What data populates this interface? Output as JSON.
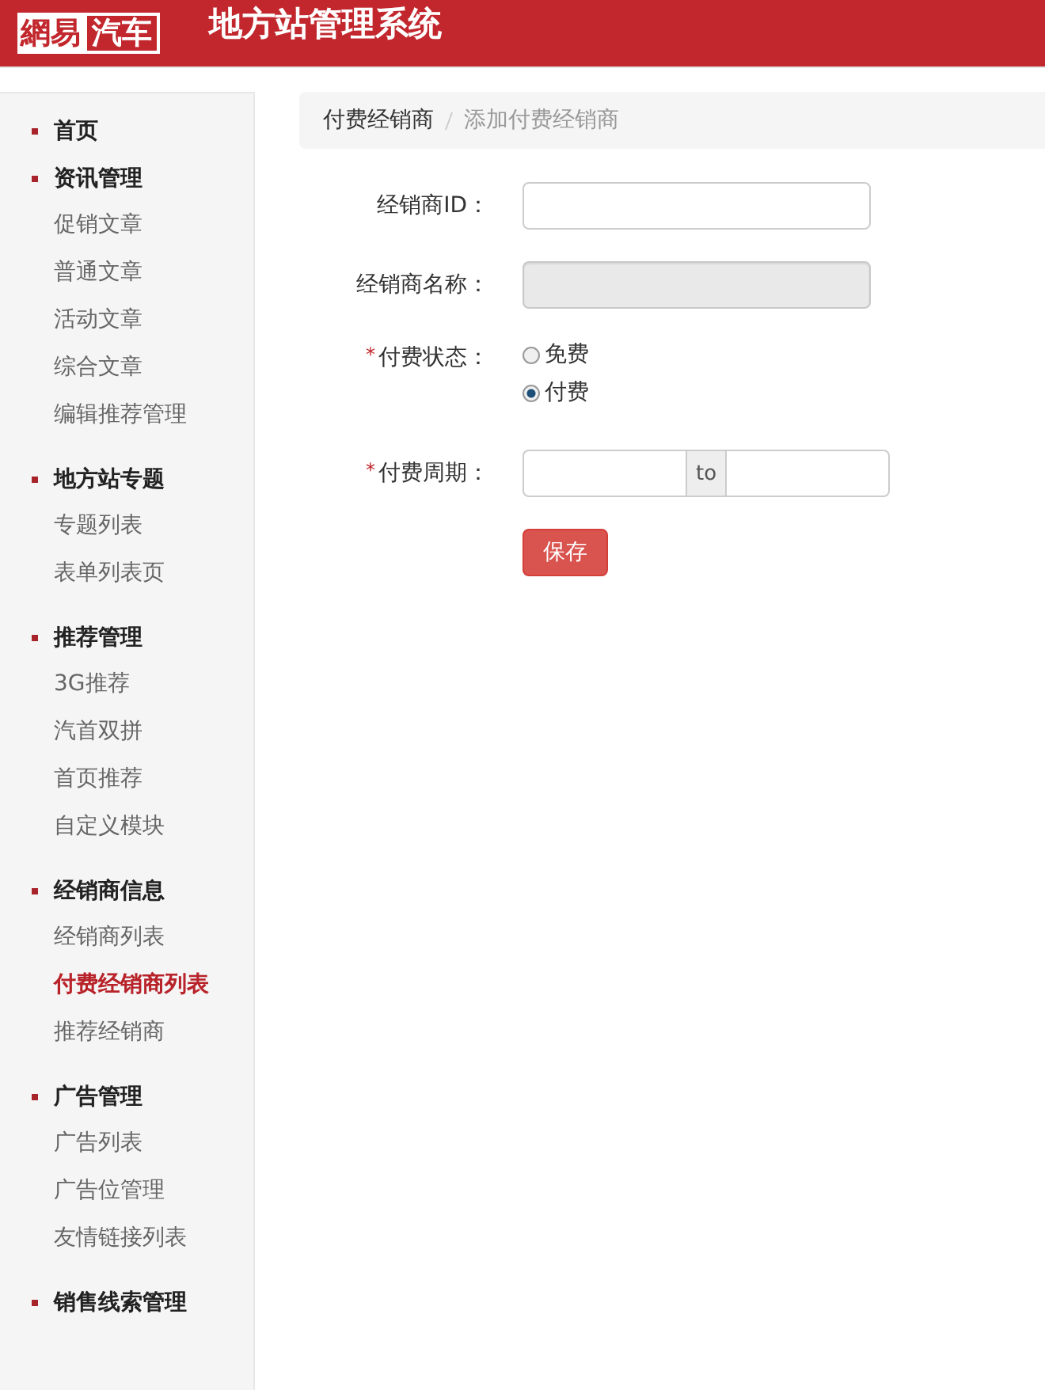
{
  "header": {
    "logo": {
      "part_1": "網易",
      "part_2": "汽车"
    },
    "title": "地方站管理系统"
  },
  "sidebar": {
    "sections": [
      {
        "title": "首页"
      },
      {
        "title": "资讯管理",
        "items": [
          {
            "label": "促销文章",
            "selected": false
          },
          {
            "label": "普通文章",
            "selected": false
          },
          {
            "label": "活动文章",
            "selected": false
          },
          {
            "label": "综合文章",
            "selected": false
          },
          {
            "label": "编辑推荐管理",
            "selected": false
          }
        ]
      },
      {
        "title": "地方站专题",
        "items": [
          {
            "label": "专题列表",
            "selected": false
          },
          {
            "label": "表单列表页",
            "selected": false
          }
        ]
      },
      {
        "title": "推荐管理",
        "items": [
          {
            "label": "3G推荐",
            "selected": false
          },
          {
            "label": "汽首双拼",
            "selected": false
          },
          {
            "label": "首页推荐",
            "selected": false
          },
          {
            "label": "自定义模块",
            "selected": false
          }
        ]
      },
      {
        "title": "经销商信息",
        "items": [
          {
            "label": "经销商列表",
            "selected": false
          },
          {
            "label": "付费经销商列表",
            "selected": true
          },
          {
            "label": "推荐经销商",
            "selected": false
          }
        ]
      },
      {
        "title": "广告管理",
        "items": [
          {
            "label": "广告列表",
            "selected": false
          },
          {
            "label": "广告位管理",
            "selected": false
          },
          {
            "label": "友情链接列表",
            "selected": false
          }
        ]
      },
      {
        "title": "销售线索管理"
      }
    ]
  },
  "breadcrumb": [
    "付费经销商",
    "添加付费经销商"
  ],
  "form": {
    "fields": [
      {
        "kind": "text",
        "label": "经销商ID：",
        "disabled": false
      },
      {
        "kind": "text",
        "label": "经销商名称：",
        "disabled": true
      },
      {
        "kind": "radio",
        "label": "付费状态：",
        "required_mark": "*",
        "options": [
          {
            "label": "免费",
            "selected": false
          },
          {
            "label": "付费",
            "selected": true
          }
        ]
      },
      {
        "kind": "range",
        "label": "付费周期：",
        "required_mark": "*",
        "separator": "to"
      }
    ],
    "save_button": "保存"
  }
}
